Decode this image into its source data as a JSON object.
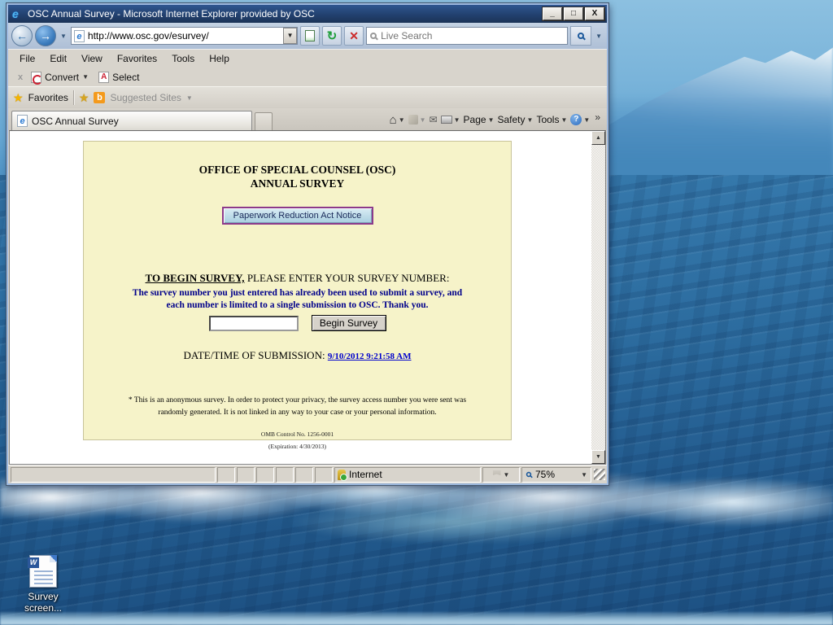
{
  "colors": {
    "titlebar_blue": "#22416f",
    "window_frame": "#9db9df",
    "chrome_gray": "#d8d4cc",
    "survey_page_bg": "#f6f3c9",
    "notice_button_border": "#8b3a8b",
    "notice_button_bg": "#b9d7e6",
    "warning_text_blue": "#00008b",
    "link_blue": "#0000cc"
  },
  "window": {
    "title": "OSC Annual Survey - Microsoft Internet Explorer provided by OSC",
    "controls": {
      "minimize": "_",
      "maximize": "□",
      "close": "X"
    }
  },
  "address_bar": {
    "url": "http://www.osc.gov/esurvey/",
    "search_placeholder": "Live Search"
  },
  "menu": {
    "items": [
      "File",
      "Edit",
      "View",
      "Favorites",
      "Tools",
      "Help"
    ]
  },
  "adobe_bar": {
    "close_label": "x",
    "convert_label": "Convert",
    "select_label": "Select",
    "dropdown_glyph": "▼"
  },
  "favorites_bar": {
    "favorites_label": "Favorites",
    "suggested_sites_label": "Suggested Sites",
    "dropdown_glyph": "▼"
  },
  "tab_bar": {
    "active_tab_title": "OSC Annual Survey",
    "page_label": "Page",
    "safety_label": "Safety",
    "tools_label": "Tools",
    "dropdown_glyph": "▼",
    "overflow_glyph": "»"
  },
  "survey_page": {
    "title_line1": "OFFICE OF SPECIAL COUNSEL (OSC)",
    "title_line2": "ANNUAL SURVEY",
    "notice_button_label": "Paperwork Reduction Act Notice",
    "begin_bold": "TO BEGIN SURVEY,",
    "begin_rest": " PLEASE ENTER YOUR SURVEY NUMBER:",
    "warning_text": "The survey number you just entered has already been used to submit a survey, and each number is limited to a single submission to OSC. Thank you.",
    "survey_number_value": "",
    "begin_button_label": "Begin Survey",
    "datetime_label": "DATE/TIME OF SUBMISSION: ",
    "datetime_link": "9/10/2012 9:21:58 AM",
    "privacy_note": "* This is an anonymous survey. In order to protect your privacy, the survey access number you were sent was randomly generated. It is not linked in any way to your case or your personal information.",
    "omb_line": "OMB Control No. 1256-0001",
    "expiration_line": "(Expiration: 4/30/2013)"
  },
  "status_bar": {
    "zone_label": "Internet",
    "zoom_label": "75%",
    "dropdown_glyph": "▼"
  },
  "desktop": {
    "doc_icon_label": "Survey screen...",
    "doc_badge": "W"
  }
}
